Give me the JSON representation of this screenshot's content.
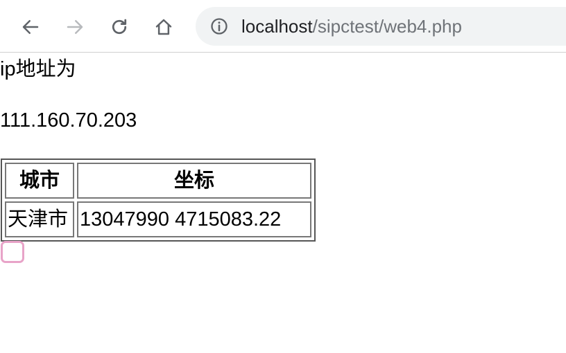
{
  "browser": {
    "url_host": "localhost",
    "url_path": "/sipctest/web4.php",
    "icons": {
      "back": "arrow-left-icon",
      "forward": "arrow-right-icon",
      "reload": "reload-icon",
      "home": "home-icon",
      "info": "info-circle-icon"
    }
  },
  "page": {
    "label": "ip地址为",
    "ip": "111.160.70.203",
    "table": {
      "headers": [
        "城市",
        "坐标"
      ],
      "rows": [
        [
          "天津市",
          "13047990 4715083.22"
        ]
      ]
    }
  },
  "colors": {
    "checkbox_border": "#e8a3c8",
    "omnibox_bg": "#f1f3f4"
  }
}
